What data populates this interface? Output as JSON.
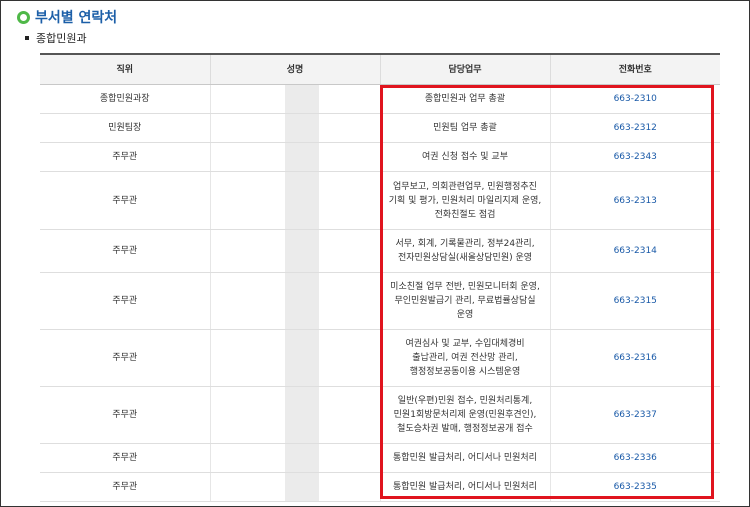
{
  "page": {
    "title": "부서별 연락처",
    "section": "종합민원과"
  },
  "table": {
    "headers": {
      "position": "직위",
      "name": "성명",
      "duty": "담당업무",
      "phone": "전화번호"
    },
    "rows": [
      {
        "position": "종합민원과장",
        "name": "",
        "duty": [
          "종합민원과 업무 총괄"
        ],
        "phone": "663-2310"
      },
      {
        "position": "민원팀장",
        "name": "",
        "duty": [
          "민원팀 업무 총괄"
        ],
        "phone": "663-2312"
      },
      {
        "position": "주무관",
        "name": "",
        "duty": [
          "여권 신청 접수 및 교부"
        ],
        "phone": "663-2343"
      },
      {
        "position": "주무관",
        "name": "",
        "duty": [
          "업무보고, 의회관련업무, 민원행정추진",
          "기획 및 평가, 민원처리 마일리지제 운영,",
          "전화친절도 점검"
        ],
        "phone": "663-2313"
      },
      {
        "position": "주무관",
        "name": "",
        "duty": [
          "서무, 회계, 기록물관리, 정부24관리,",
          "전자민원상담실(새올상담민원) 운영"
        ],
        "phone": "663-2314"
      },
      {
        "position": "주무관",
        "name": "",
        "duty": [
          "미소친절 업무 전반, 민원모니터회 운영,",
          "무인민원발급기 관리, 무료법률상담실",
          "운영"
        ],
        "phone": "663-2315"
      },
      {
        "position": "주무관",
        "name": "",
        "duty": [
          "여권심사 및 교부, 수입대체경비",
          "출납관리, 여권 전산망 관리,",
          "행정정보공동이용 시스템운영"
        ],
        "phone": "663-2316"
      },
      {
        "position": "주무관",
        "name": "",
        "duty": [
          "일반(우편)민원 접수, 민원처리통계,",
          "민원1회방문처리제 운영(민원후견인),",
          "철도승차권 발매, 행정정보공개 접수"
        ],
        "phone": "663-2337"
      },
      {
        "position": "주무관",
        "name": "",
        "duty": [
          "통합민원 발급처리, 어디서나 민원처리"
        ],
        "phone": "663-2336"
      },
      {
        "position": "주무관",
        "name": "",
        "duty": [
          "통합민원 발급처리, 어디서나 민원처리"
        ],
        "phone": "663-2335"
      }
    ]
  },
  "colors": {
    "accent_blue": "#1c5fa8",
    "highlight_red": "#e0141e",
    "logo_green": "#4fb848"
  }
}
